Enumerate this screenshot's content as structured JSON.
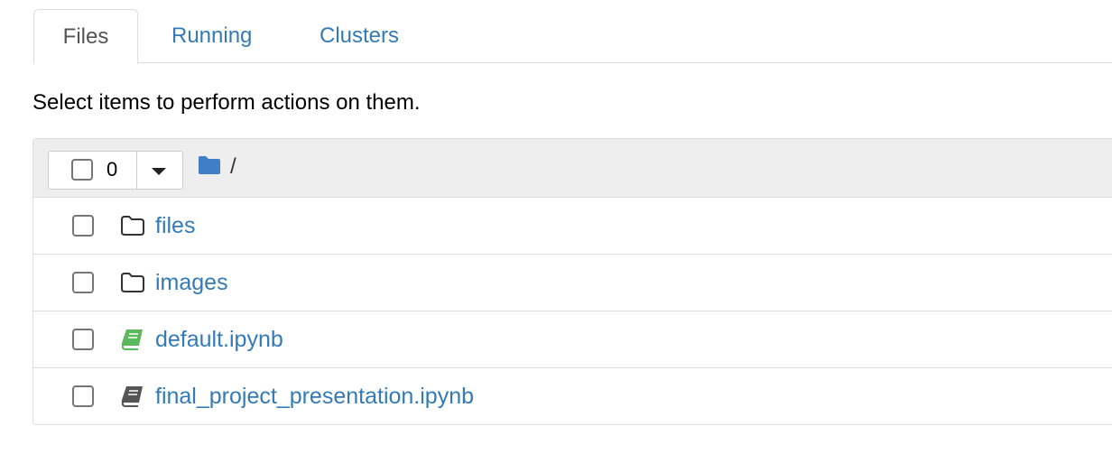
{
  "tabs": [
    {
      "label": "Files",
      "active": true
    },
    {
      "label": "Running",
      "active": false
    },
    {
      "label": "Clusters",
      "active": false
    }
  ],
  "instructions": "Select items to perform actions on them.",
  "toolbar": {
    "selected_count": "0",
    "breadcrumb": "/",
    "breadcrumb_icon": "folder-solid-icon"
  },
  "items": [
    {
      "name": "files",
      "icon": "folder-outline-icon",
      "type": "directory",
      "checked": false
    },
    {
      "name": "images",
      "icon": "folder-outline-icon",
      "type": "directory",
      "checked": false
    },
    {
      "name": "default.ipynb",
      "icon": "notebook-icon",
      "type": "notebook",
      "running": true,
      "checked": false
    },
    {
      "name": "final_project_presentation.ipynb",
      "icon": "notebook-icon",
      "type": "notebook",
      "running": false,
      "checked": false
    }
  ],
  "colors": {
    "link": "#337ab7",
    "running_notebook": "#5cb85c",
    "idle_notebook": "#555555",
    "folder_solid": "#3f7fc6"
  }
}
